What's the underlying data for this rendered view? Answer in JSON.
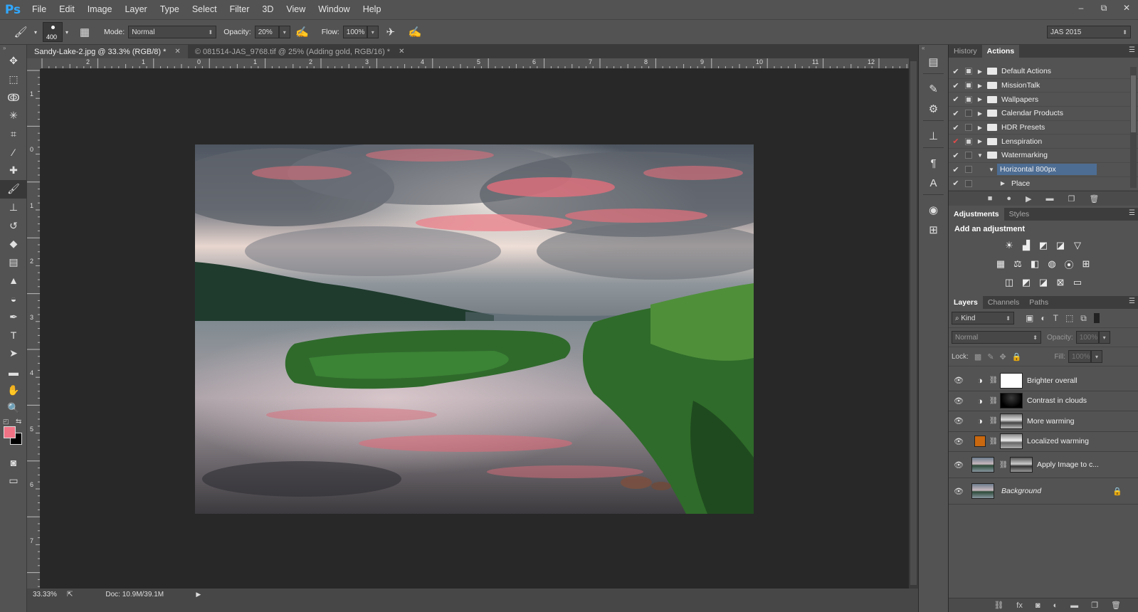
{
  "app": {
    "logo": "Ps"
  },
  "menu": [
    "File",
    "Edit",
    "Image",
    "Layer",
    "Type",
    "Select",
    "Filter",
    "3D",
    "View",
    "Window",
    "Help"
  ],
  "window_controls": {
    "minimize": "–",
    "restore": "⧉",
    "close": "✕"
  },
  "options": {
    "brush_size": "400",
    "mode_label": "Mode:",
    "mode_value": "Normal",
    "opacity_label": "Opacity:",
    "opacity_value": "20%",
    "flow_label": "Flow:",
    "flow_value": "100%",
    "workspace": "JAS 2015"
  },
  "tabs": [
    {
      "label": "Sandy-Lake-2.jpg @ 33.3% (RGB/8) *",
      "active": true
    },
    {
      "label": "© 081514-JAS_9768.tif @ 25% (Adding gold, RGB/16) *",
      "active": false
    }
  ],
  "rulers": {
    "top": [
      "2",
      "1",
      "0",
      "1",
      "2",
      "3",
      "4",
      "5",
      "6",
      "7",
      "8",
      "9",
      "10",
      "11",
      "12"
    ],
    "left": [
      "1",
      "0",
      "1",
      "2",
      "3",
      "4",
      "5",
      "6",
      "7"
    ]
  },
  "status": {
    "zoom": "33.33%",
    "doc": "Doc: 10.9M/39.1M"
  },
  "history_panel": {
    "tabs": [
      "History",
      "Actions"
    ]
  },
  "actions": [
    {
      "label": "Default Actions",
      "dialog": true,
      "indent": 0,
      "expanded": false,
      "folder": true,
      "red": false
    },
    {
      "label": "MissionTalk",
      "dialog": true,
      "indent": 0,
      "expanded": false,
      "folder": true,
      "red": false
    },
    {
      "label": "Wallpapers",
      "dialog": true,
      "indent": 0,
      "expanded": false,
      "folder": true,
      "red": false
    },
    {
      "label": "Calendar Products",
      "dialog": false,
      "indent": 0,
      "expanded": false,
      "folder": true,
      "red": false
    },
    {
      "label": "HDR Presets",
      "dialog": false,
      "indent": 0,
      "expanded": false,
      "folder": true,
      "red": false
    },
    {
      "label": "Lenspiration",
      "dialog": true,
      "indent": 0,
      "expanded": false,
      "folder": true,
      "red": true
    },
    {
      "label": "Watermarking",
      "dialog": false,
      "indent": 0,
      "expanded": true,
      "folder": true,
      "red": false
    },
    {
      "label": "Horizontal 800px",
      "dialog": false,
      "indent": 1,
      "expanded": true,
      "folder": false,
      "red": false,
      "selected": true
    },
    {
      "label": "Place",
      "dialog": false,
      "indent": 2,
      "expanded": false,
      "folder": false,
      "red": false
    }
  ],
  "adjustments_panel": {
    "tabs": [
      "Adjustments",
      "Styles"
    ],
    "title": "Add an adjustment"
  },
  "layers_panel": {
    "tabs": [
      "Layers",
      "Channels",
      "Paths"
    ],
    "kind": "Kind",
    "blend_mode": "Normal",
    "opacity_label": "Opacity:",
    "opacity_value": "100%",
    "lock_label": "Lock:",
    "fill_label": "Fill:",
    "fill_value": "100%"
  },
  "layers": [
    {
      "name": "Brighter overall",
      "type": "curves",
      "mask": "white"
    },
    {
      "name": "Contrast in clouds",
      "type": "curves",
      "mask": "dark"
    },
    {
      "name": "More warming",
      "type": "curves",
      "mask": "mid"
    },
    {
      "name": "Localized warming",
      "type": "solid",
      "mask": "mid2"
    },
    {
      "name": "Apply Image to c...",
      "type": "image",
      "mask": "mid3"
    },
    {
      "name": "Background",
      "type": "background",
      "mask": null
    }
  ],
  "colors": {
    "foreground": "#f07285",
    "background": "#000000",
    "selection": "#4e6d93",
    "brand": "#31a8ff"
  }
}
